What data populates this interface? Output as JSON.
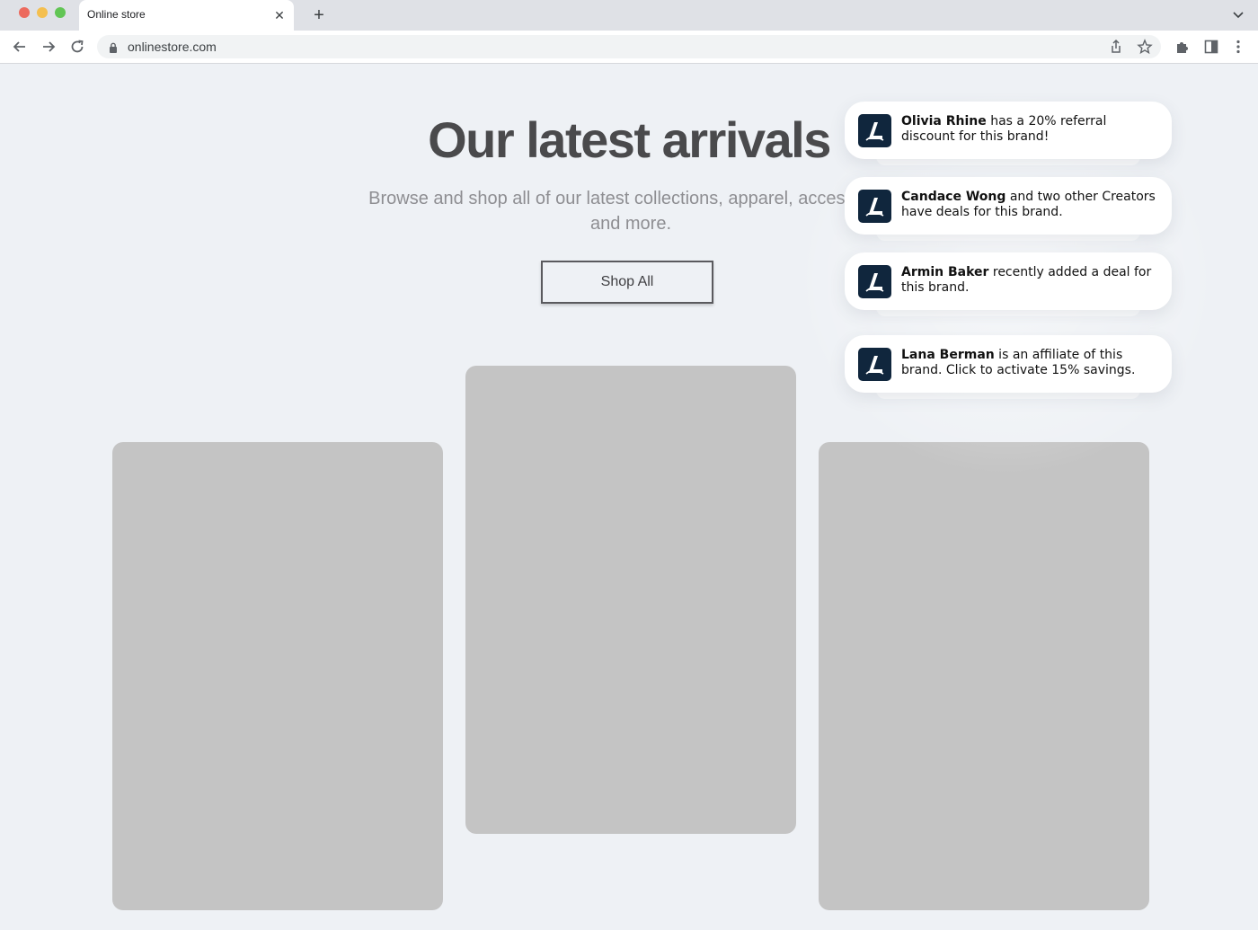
{
  "browser": {
    "tab_title": "Online store",
    "url": "onlinestore.com"
  },
  "page": {
    "title": "Our latest arrivals",
    "subtitle": "Browse and shop all of our latest collections, apparel, accessories and more.",
    "cta_label": "Shop All"
  },
  "notifications": [
    {
      "name": "Olivia Rhine",
      "text": " has a 20% referral discount for this brand!"
    },
    {
      "name": "Candace Wong",
      "text": " and two other Creators have deals for this brand."
    },
    {
      "name": "Armin Baker",
      "text": " recently added a deal for this brand."
    },
    {
      "name": "Lana Berman",
      "text": " is an affiliate of this brand. Click to activate 15% savings."
    }
  ],
  "colors": {
    "page_bg": "#eef1f5",
    "card_placeholder": "#c4c4c4",
    "logo_bg": "#10263d"
  },
  "icons": [
    "back-arrow-icon",
    "forward-arrow-icon",
    "reload-icon",
    "lock-icon",
    "share-icon",
    "star-icon",
    "puzzle-icon",
    "side-panel-icon",
    "kebab-menu-icon",
    "close-icon",
    "plus-icon",
    "chevron-down-icon",
    "brand-logo-icon"
  ]
}
